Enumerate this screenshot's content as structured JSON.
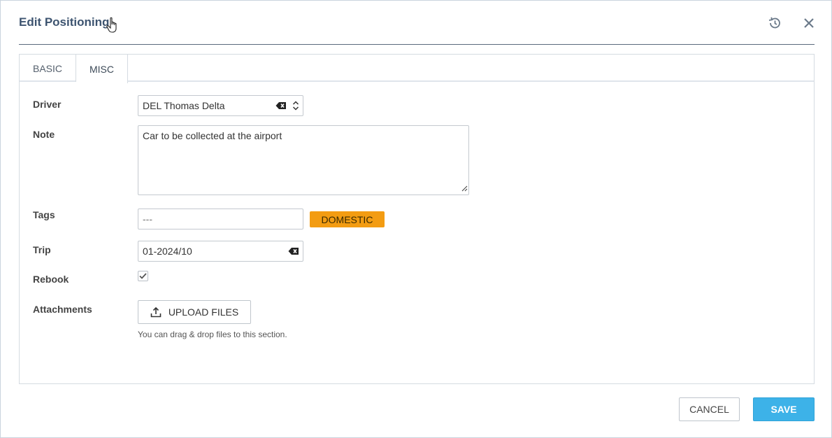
{
  "dialog": {
    "title": "Edit Positioning",
    "history_icon": "history-icon",
    "close_icon": "close-icon"
  },
  "tabs": [
    {
      "label": "BASIC",
      "active": false
    },
    {
      "label": "MISC",
      "active": true
    }
  ],
  "form": {
    "driver": {
      "label": "Driver",
      "value": "DEL Thomas Delta"
    },
    "note": {
      "label": "Note",
      "value": "Car to be collected at the airport"
    },
    "tags": {
      "label": "Tags",
      "placeholder": "---",
      "badge": "DOMESTIC",
      "badge_color": "#f39c12"
    },
    "trip": {
      "label": "Trip",
      "value": "01-2024/10"
    },
    "rebook": {
      "label": "Rebook",
      "checked": true
    },
    "attachments": {
      "label": "Attachments",
      "upload_label": "UPLOAD FILES",
      "hint": "You can drag & drop files to this section."
    }
  },
  "footer": {
    "cancel_label": "CANCEL",
    "save_label": "SAVE",
    "save_color": "#3db2e8"
  }
}
